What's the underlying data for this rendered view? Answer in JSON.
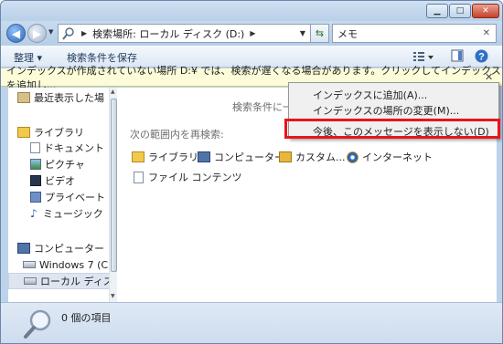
{
  "address": {
    "path": "検索場所: ローカル ディスク (D:)",
    "search_value": "メモ"
  },
  "toolbar": {
    "organize_label": "整理 ▾",
    "save_search_label": "検索条件を保存"
  },
  "infobar": {
    "text": "インデックスが作成されていない場所 D:¥ では、検索が遅くなる場合があります。クリックしてインデックスを追加し..."
  },
  "sidebar": {
    "items": [
      {
        "label": "最近表示した場",
        "icon": "recent-places-icon"
      },
      {
        "label": "ライブラリ",
        "icon": "library-icon"
      },
      {
        "label": "ドキュメント",
        "icon": "documents-icon"
      },
      {
        "label": "ピクチャ",
        "icon": "pictures-icon"
      },
      {
        "label": "ビデオ",
        "icon": "videos-icon"
      },
      {
        "label": "プライベート",
        "icon": "private-folder-icon"
      },
      {
        "label": "ミュージック",
        "icon": "music-icon"
      },
      {
        "label": "コンピューター",
        "icon": "computer-icon"
      },
      {
        "label": "Windows 7 (C:)",
        "icon": "drive-c-icon"
      },
      {
        "label": "ローカル ディス",
        "icon": "drive-d-icon"
      }
    ]
  },
  "content": {
    "empty_message": "検索条件に一致",
    "search_again_label": "次の範囲内を再検索:",
    "locations": [
      {
        "label": "ライブラリ",
        "icon": "library-icon"
      },
      {
        "label": "コンピューター",
        "icon": "computer-icon"
      },
      {
        "label": "カスタム...",
        "icon": "folder-icon"
      },
      {
        "label": "インターネット",
        "icon": "internet-explorer-icon"
      },
      {
        "label": "ファイル コンテンツ",
        "icon": "file-contents-icon"
      }
    ]
  },
  "context_menu": {
    "items": [
      {
        "label": "インデックスに追加(A)..."
      },
      {
        "label": "インデックスの場所の変更(M)..."
      },
      {
        "label": "今後、このメッセージを表示しない(D)"
      }
    ]
  },
  "status": {
    "item_count": "0 個の項目"
  },
  "colors": {
    "highlight": "#e8151a",
    "infobar_bg": "#fdfcd8"
  }
}
